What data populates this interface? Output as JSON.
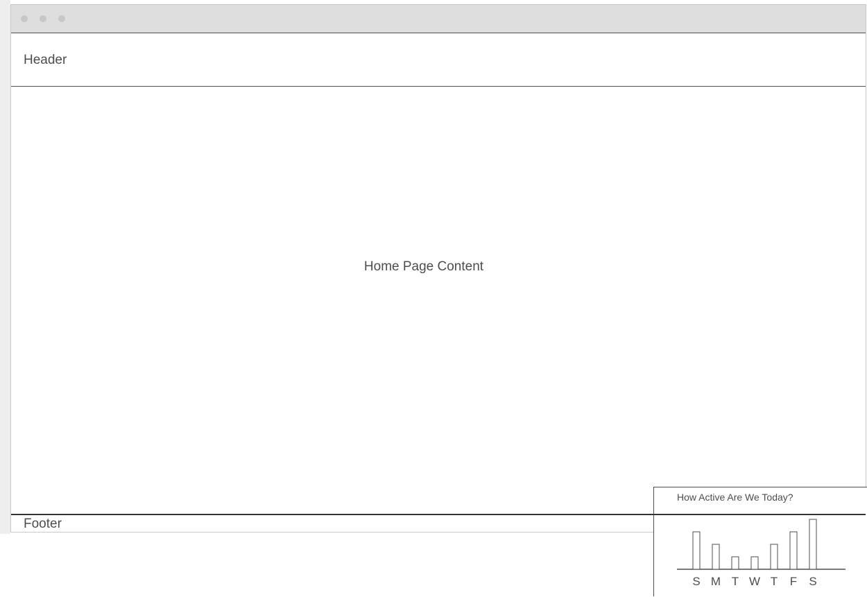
{
  "header": {
    "title": "Header"
  },
  "main": {
    "label": "Home Page Content"
  },
  "widget": {
    "title": "How Active Are We Today?"
  },
  "chart_data": {
    "type": "bar",
    "categories": [
      "S",
      "M",
      "T",
      "W",
      "T",
      "F",
      "S"
    ],
    "values": [
      3,
      2,
      1,
      1,
      2,
      3,
      4
    ],
    "title": "How Active Are We Today?",
    "xlabel": "",
    "ylabel": "",
    "ylim": [
      0,
      4
    ],
    "grid": false
  },
  "footer": {
    "label": "Footer"
  },
  "colors": {
    "stroke": "#4d4d4d",
    "titlebar": "#dedede",
    "dot": "#c7c7c7"
  }
}
